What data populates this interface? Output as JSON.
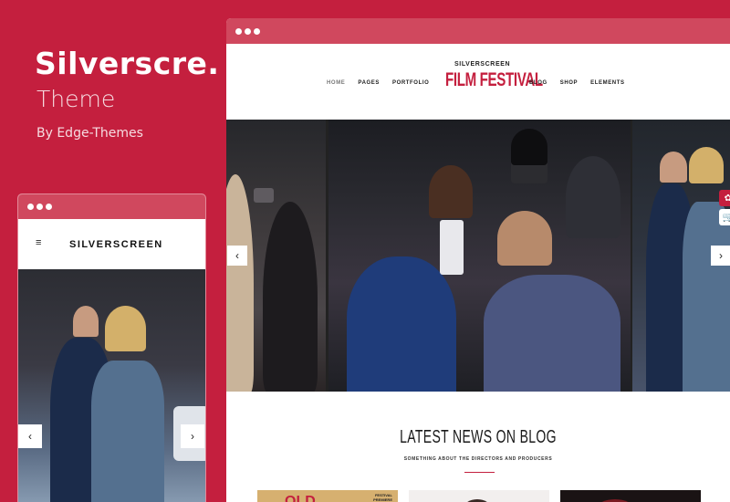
{
  "promo": {
    "title": "Silverscre..",
    "subtitle": "Theme",
    "author": "By Edge-Themes"
  },
  "desktop": {
    "nav_left": [
      "HOME",
      "PAGES",
      "PORTFOLIO"
    ],
    "nav_right": [
      "BLOG",
      "SHOP",
      "ELEMENTS"
    ],
    "logo_small": "SILVERSCREEN",
    "logo_big": "FILM FESTIVAL",
    "slider_prev": "‹",
    "slider_next": "›",
    "news_title": "LATEST NEWS ON BLOG",
    "news_subtitle": "SOMETHING ABOUT THE DIRECTORS AND PRODUCERS",
    "thumb_text": "FESTIVAL PREMIERE"
  },
  "mobile": {
    "menu_icon": "≡",
    "logo": "SILVERSCREEN",
    "slider_prev": "‹",
    "slider_next": "›"
  },
  "colors": {
    "brand": "#c41f3e",
    "browser_bar": "#d0485e"
  },
  "icons": [
    "menu-icon",
    "chevron-left-icon",
    "chevron-right-icon",
    "cart-icon",
    "settings-icon"
  ]
}
